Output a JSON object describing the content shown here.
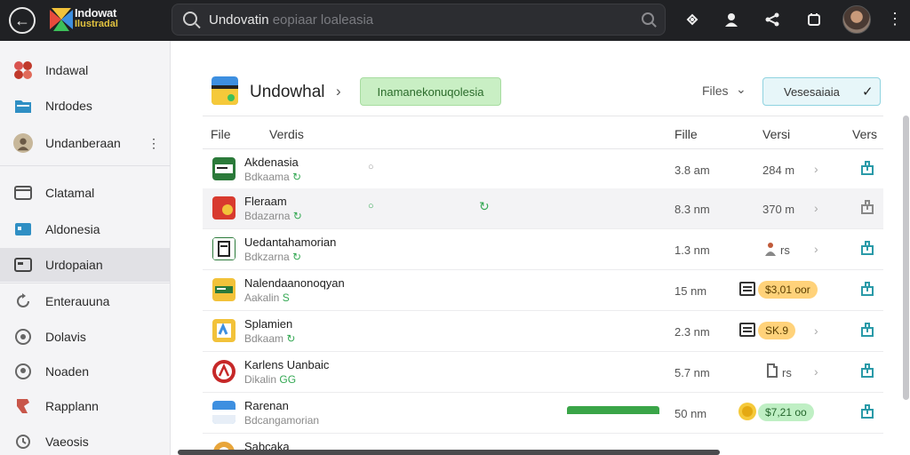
{
  "topbar": {
    "brand_line1": "Indowat",
    "brand_line2": "Ilustradal",
    "search_value": "Undovatin",
    "search_placeholder": "eopiaar loaleasia"
  },
  "sidebar": {
    "items": [
      {
        "label": "Indawal",
        "icon": "apps-cluster-icon"
      },
      {
        "label": "Nrdodes",
        "icon": "folder-icon"
      },
      {
        "label": "Undanberaan",
        "icon": "profile-icon"
      },
      {
        "label": "Clatamal",
        "icon": "window-icon"
      },
      {
        "label": "Aldonesia",
        "icon": "monitor-icon"
      },
      {
        "label": "Urdopaian",
        "icon": "folder-outline-icon"
      },
      {
        "label": "Enterauuna",
        "icon": "refresh-icon"
      },
      {
        "label": "Dolavis",
        "icon": "circle-check-icon"
      },
      {
        "label": "Noaden",
        "icon": "pin-icon"
      },
      {
        "label": "Rapplann",
        "icon": "chat-icon"
      },
      {
        "label": "Vaeosis",
        "icon": "clock-icon"
      }
    ],
    "more_glyph": "⋮"
  },
  "header": {
    "title": "Undowhal",
    "pill": "Inamanekonuqolesia",
    "files": "Files",
    "version_select": "Vesesaiaia"
  },
  "table": {
    "columns": [
      "File",
      "Verdis",
      "Fille",
      "Versi",
      "Vers"
    ],
    "rows": [
      {
        "name": "Akdenasia",
        "sub": "Bdkaama",
        "sub_icon": "↻",
        "size": "3.8 am",
        "version": "284 m"
      },
      {
        "name": "Fleraam",
        "sub": "Bdazarna",
        "sub_icon": "↻",
        "size": "8.3 nm",
        "version": "370 m"
      },
      {
        "name": "Uedantahamorian",
        "sub": "Bdkzarna",
        "sub_icon": "↻",
        "size": "1.3 nm",
        "version": "rs"
      },
      {
        "name": "Nalendaanonoqyan",
        "sub": "Aakalin",
        "sub_icon": "S",
        "size": "15 nm",
        "badge": "$3,01 oor"
      },
      {
        "name": "Splamien",
        "sub": "Bdkaam",
        "sub_icon": "↻",
        "size": "2.3 nm",
        "badge": "SK.9"
      },
      {
        "name": "Karlens Uanbaic",
        "sub": "Dikalin",
        "sub_icon": "GG",
        "size": "5.7 nm",
        "version": "rs"
      },
      {
        "name": "Rarenan",
        "sub": "Bdcangamorian",
        "sub_icon": "",
        "size": "50 nm",
        "badge": "$7,21 oo"
      },
      {
        "name": "Sabcaka",
        "sub": "",
        "sub_icon": "",
        "size": "",
        "version": ""
      }
    ]
  }
}
